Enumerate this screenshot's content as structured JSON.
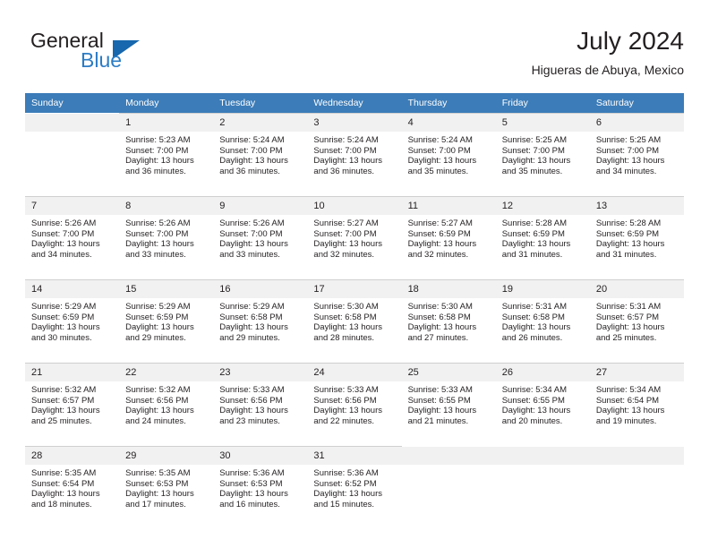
{
  "brand": {
    "word_one": "General",
    "word_two": "Blue",
    "accent_color": "#2b7cc4",
    "triangle_color": "#1667ad"
  },
  "header": {
    "title": "July 2024",
    "subtitle": "Higueras de Abuya, Mexico",
    "header_bg": "#3c7cb8",
    "daynum_bg": "#f1f1f1"
  },
  "weekday_headers": [
    "Sunday",
    "Monday",
    "Tuesday",
    "Wednesday",
    "Thursday",
    "Friday",
    "Saturday"
  ],
  "labels": {
    "sunrise_prefix": "Sunrise:",
    "sunset_prefix": "Sunset:",
    "daylight_prefix": "Daylight:"
  },
  "weeks": [
    [
      {
        "day": "",
        "lines": []
      },
      {
        "day": "1",
        "lines": [
          "Sunrise: 5:23 AM",
          "Sunset: 7:00 PM",
          "Daylight: 13 hours",
          "and 36 minutes."
        ]
      },
      {
        "day": "2",
        "lines": [
          "Sunrise: 5:24 AM",
          "Sunset: 7:00 PM",
          "Daylight: 13 hours",
          "and 36 minutes."
        ]
      },
      {
        "day": "3",
        "lines": [
          "Sunrise: 5:24 AM",
          "Sunset: 7:00 PM",
          "Daylight: 13 hours",
          "and 36 minutes."
        ]
      },
      {
        "day": "4",
        "lines": [
          "Sunrise: 5:24 AM",
          "Sunset: 7:00 PM",
          "Daylight: 13 hours",
          "and 35 minutes."
        ]
      },
      {
        "day": "5",
        "lines": [
          "Sunrise: 5:25 AM",
          "Sunset: 7:00 PM",
          "Daylight: 13 hours",
          "and 35 minutes."
        ]
      },
      {
        "day": "6",
        "lines": [
          "Sunrise: 5:25 AM",
          "Sunset: 7:00 PM",
          "Daylight: 13 hours",
          "and 34 minutes."
        ]
      }
    ],
    [
      {
        "day": "7",
        "lines": [
          "Sunrise: 5:26 AM",
          "Sunset: 7:00 PM",
          "Daylight: 13 hours",
          "and 34 minutes."
        ]
      },
      {
        "day": "8",
        "lines": [
          "Sunrise: 5:26 AM",
          "Sunset: 7:00 PM",
          "Daylight: 13 hours",
          "and 33 minutes."
        ]
      },
      {
        "day": "9",
        "lines": [
          "Sunrise: 5:26 AM",
          "Sunset: 7:00 PM",
          "Daylight: 13 hours",
          "and 33 minutes."
        ]
      },
      {
        "day": "10",
        "lines": [
          "Sunrise: 5:27 AM",
          "Sunset: 7:00 PM",
          "Daylight: 13 hours",
          "and 32 minutes."
        ]
      },
      {
        "day": "11",
        "lines": [
          "Sunrise: 5:27 AM",
          "Sunset: 6:59 PM",
          "Daylight: 13 hours",
          "and 32 minutes."
        ]
      },
      {
        "day": "12",
        "lines": [
          "Sunrise: 5:28 AM",
          "Sunset: 6:59 PM",
          "Daylight: 13 hours",
          "and 31 minutes."
        ]
      },
      {
        "day": "13",
        "lines": [
          "Sunrise: 5:28 AM",
          "Sunset: 6:59 PM",
          "Daylight: 13 hours",
          "and 31 minutes."
        ]
      }
    ],
    [
      {
        "day": "14",
        "lines": [
          "Sunrise: 5:29 AM",
          "Sunset: 6:59 PM",
          "Daylight: 13 hours",
          "and 30 minutes."
        ]
      },
      {
        "day": "15",
        "lines": [
          "Sunrise: 5:29 AM",
          "Sunset: 6:59 PM",
          "Daylight: 13 hours",
          "and 29 minutes."
        ]
      },
      {
        "day": "16",
        "lines": [
          "Sunrise: 5:29 AM",
          "Sunset: 6:58 PM",
          "Daylight: 13 hours",
          "and 29 minutes."
        ]
      },
      {
        "day": "17",
        "lines": [
          "Sunrise: 5:30 AM",
          "Sunset: 6:58 PM",
          "Daylight: 13 hours",
          "and 28 minutes."
        ]
      },
      {
        "day": "18",
        "lines": [
          "Sunrise: 5:30 AM",
          "Sunset: 6:58 PM",
          "Daylight: 13 hours",
          "and 27 minutes."
        ]
      },
      {
        "day": "19",
        "lines": [
          "Sunrise: 5:31 AM",
          "Sunset: 6:58 PM",
          "Daylight: 13 hours",
          "and 26 minutes."
        ]
      },
      {
        "day": "20",
        "lines": [
          "Sunrise: 5:31 AM",
          "Sunset: 6:57 PM",
          "Daylight: 13 hours",
          "and 25 minutes."
        ]
      }
    ],
    [
      {
        "day": "21",
        "lines": [
          "Sunrise: 5:32 AM",
          "Sunset: 6:57 PM",
          "Daylight: 13 hours",
          "and 25 minutes."
        ]
      },
      {
        "day": "22",
        "lines": [
          "Sunrise: 5:32 AM",
          "Sunset: 6:56 PM",
          "Daylight: 13 hours",
          "and 24 minutes."
        ]
      },
      {
        "day": "23",
        "lines": [
          "Sunrise: 5:33 AM",
          "Sunset: 6:56 PM",
          "Daylight: 13 hours",
          "and 23 minutes."
        ]
      },
      {
        "day": "24",
        "lines": [
          "Sunrise: 5:33 AM",
          "Sunset: 6:56 PM",
          "Daylight: 13 hours",
          "and 22 minutes."
        ]
      },
      {
        "day": "25",
        "lines": [
          "Sunrise: 5:33 AM",
          "Sunset: 6:55 PM",
          "Daylight: 13 hours",
          "and 21 minutes."
        ]
      },
      {
        "day": "26",
        "lines": [
          "Sunrise: 5:34 AM",
          "Sunset: 6:55 PM",
          "Daylight: 13 hours",
          "and 20 minutes."
        ]
      },
      {
        "day": "27",
        "lines": [
          "Sunrise: 5:34 AM",
          "Sunset: 6:54 PM",
          "Daylight: 13 hours",
          "and 19 minutes."
        ]
      }
    ],
    [
      {
        "day": "28",
        "lines": [
          "Sunrise: 5:35 AM",
          "Sunset: 6:54 PM",
          "Daylight: 13 hours",
          "and 18 minutes."
        ]
      },
      {
        "day": "29",
        "lines": [
          "Sunrise: 5:35 AM",
          "Sunset: 6:53 PM",
          "Daylight: 13 hours",
          "and 17 minutes."
        ]
      },
      {
        "day": "30",
        "lines": [
          "Sunrise: 5:36 AM",
          "Sunset: 6:53 PM",
          "Daylight: 13 hours",
          "and 16 minutes."
        ]
      },
      {
        "day": "31",
        "lines": [
          "Sunrise: 5:36 AM",
          "Sunset: 6:52 PM",
          "Daylight: 13 hours",
          "and 15 minutes."
        ]
      },
      {
        "day": "",
        "lines": []
      },
      {
        "day": "",
        "lines": []
      },
      {
        "day": "",
        "lines": []
      }
    ]
  ]
}
